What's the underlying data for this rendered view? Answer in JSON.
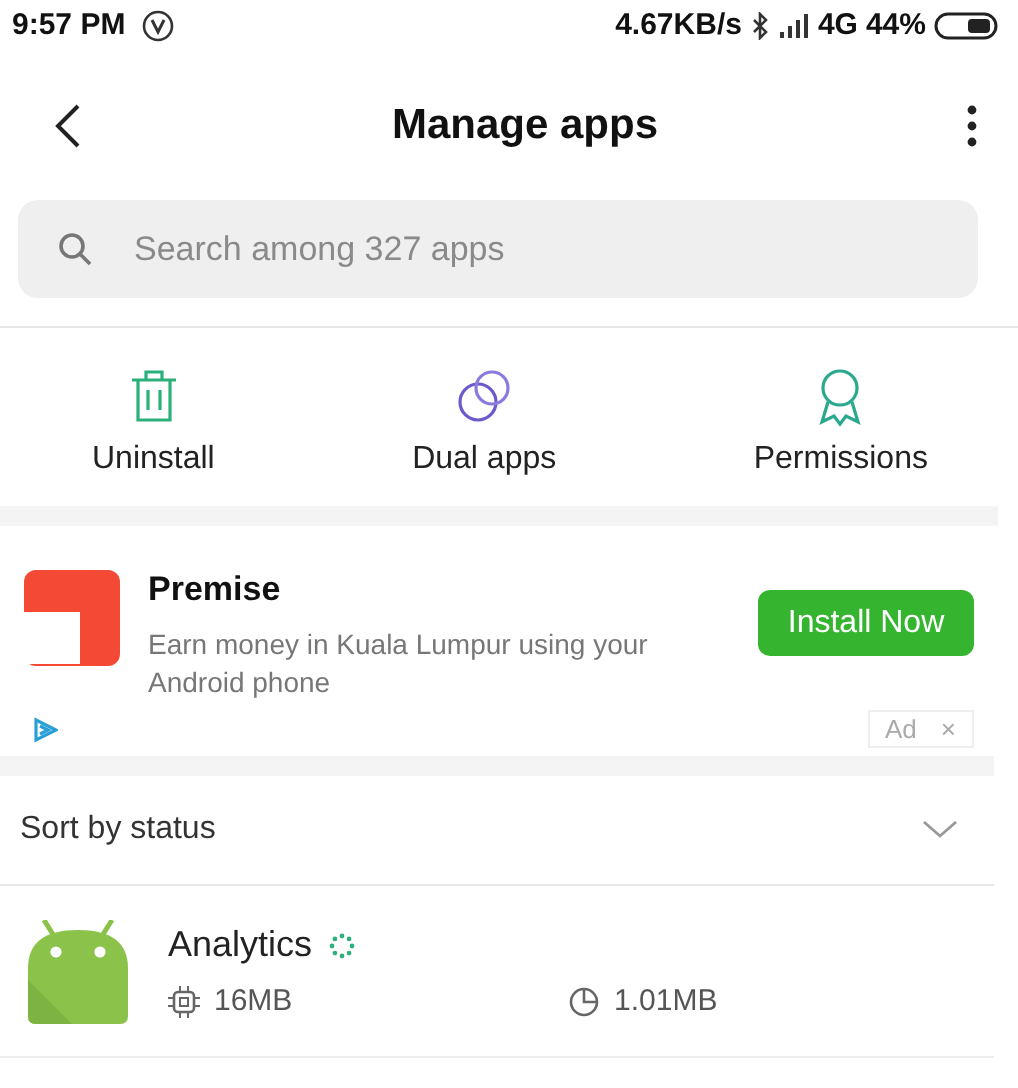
{
  "status_bar": {
    "time": "9:57 PM",
    "speed": "4.67KB/s",
    "network": "4G",
    "battery": "44%"
  },
  "header": {
    "title": "Manage apps"
  },
  "search": {
    "placeholder": "Search among 327 apps"
  },
  "actions": [
    {
      "kind": "trash",
      "label": "Uninstall"
    },
    {
      "kind": "dual",
      "label": "Dual apps"
    },
    {
      "kind": "badge",
      "label": "Permissions"
    }
  ],
  "ad": {
    "title": "Premise",
    "description": "Earn money in Kuala Lumpur using your Android phone",
    "button": "Install Now",
    "tag": "Ad",
    "close": "×"
  },
  "sort": {
    "label": "Sort by status"
  },
  "apps": [
    {
      "name": "Analytics",
      "loading": true,
      "memory": "16MB",
      "storage": "1.01MB"
    }
  ]
}
